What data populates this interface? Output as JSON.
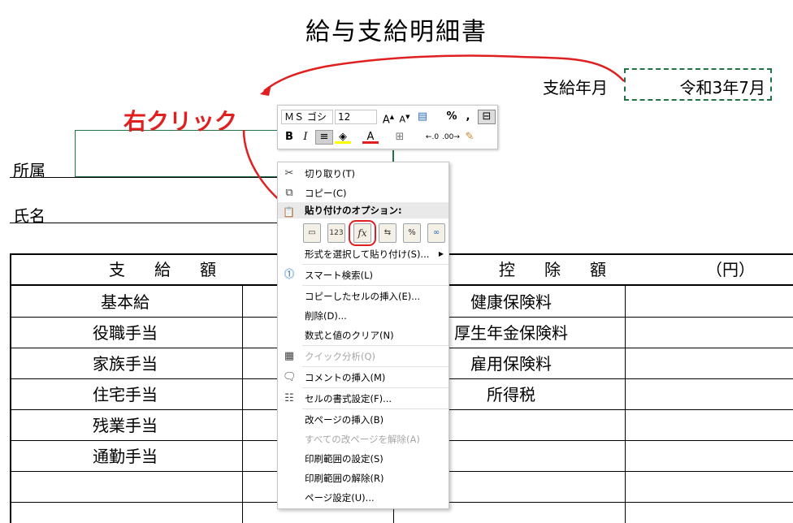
{
  "title": "給与支給明細書",
  "pay_month": {
    "label": "支給年月",
    "value": "令和3年7月"
  },
  "affiliation_label": "所属",
  "name_label": "氏名",
  "annotation": {
    "text": "右クリック",
    "color": "#e02020"
  },
  "table": {
    "left_header": "支　給　額",
    "right_header": "控　除　額",
    "unit": "（円）",
    "left_rows": [
      "基本給",
      "役職手当",
      "家族手当",
      "住宅手当",
      "残業手当",
      "通勤手当",
      "",
      ""
    ],
    "right_rows": [
      "健康保険料",
      "厚生年金保険料",
      "雇用保険料",
      "所得税",
      "",
      "",
      "",
      ""
    ]
  },
  "mini_toolbar": {
    "font_name": "ＭＳ ゴシ",
    "font_size": "12",
    "buttons": [
      "font-grow",
      "font-shrink",
      "number-format",
      "percent",
      "comma",
      "merge",
      "bold",
      "italic",
      "align-center",
      "fill-color",
      "font-color",
      "borders",
      "increase-decimal",
      "decrease-decimal",
      "format-painter"
    ],
    "bold_label": "B",
    "italic_label": "I",
    "percent_label": "%",
    "comma_label": ","
  },
  "context_menu": {
    "items": [
      {
        "label": "切り取り(T)",
        "icon": "scissors-icon",
        "disabled": false
      },
      {
        "label": "コピー(C)",
        "icon": "copy-icon",
        "disabled": false
      },
      {
        "label": "貼り付けのオプション:",
        "icon": "paste-icon",
        "header": true
      },
      {
        "label": "形式を選択して貼り付け(S)...",
        "icon": "",
        "disabled": false,
        "submenu": true
      },
      {
        "label": "スマート検索(L)",
        "icon": "smart-lookup-icon",
        "disabled": false
      },
      {
        "label": "コピーしたセルの挿入(E)...",
        "icon": "",
        "disabled": false
      },
      {
        "label": "削除(D)...",
        "icon": "",
        "disabled": false
      },
      {
        "label": "数式と値のクリア(N)",
        "icon": "",
        "disabled": false
      },
      {
        "label": "クイック分析(Q)",
        "icon": "quick-analysis-icon",
        "disabled": true
      },
      {
        "label": "コメントの挿入(M)",
        "icon": "comment-icon",
        "disabled": false
      },
      {
        "label": "セルの書式設定(F)...",
        "icon": "format-cells-icon",
        "disabled": false
      },
      {
        "label": "改ページの挿入(B)",
        "icon": "",
        "disabled": false
      },
      {
        "label": "すべての改ページを解除(A)",
        "icon": "",
        "disabled": true
      },
      {
        "label": "印刷範囲の設定(S)",
        "icon": "",
        "disabled": false
      },
      {
        "label": "印刷範囲の解除(R)",
        "icon": "",
        "disabled": false
      },
      {
        "label": "ページ設定(U)...",
        "icon": "",
        "disabled": false
      }
    ],
    "paste_options": [
      "paste-icon",
      "paste-values-icon",
      "paste-formulas-icon",
      "paste-transpose-icon",
      "paste-formatting-icon",
      "paste-link-icon"
    ],
    "paste_values_label": "123",
    "paste_formulas_label": "fx",
    "paste_format_label": "%"
  },
  "colors": {
    "accent_red": "#e02020",
    "green_border": "#217346"
  }
}
